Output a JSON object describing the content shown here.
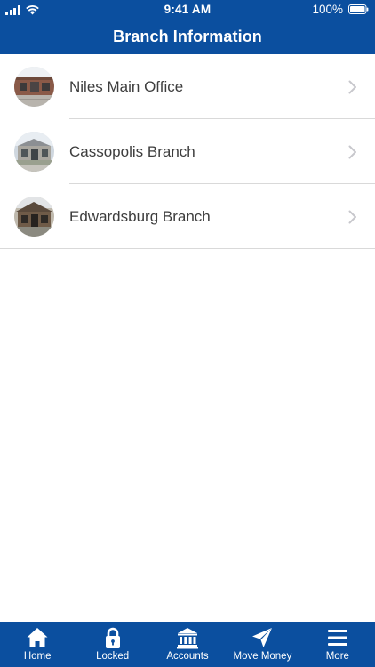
{
  "status_bar": {
    "time": "9:41 AM",
    "battery_percent": "100%"
  },
  "nav": {
    "title": "Branch Information"
  },
  "branches": [
    {
      "name": "Niles Main Office",
      "thumbnail": "niles-building-photo"
    },
    {
      "name": "Cassopolis Branch",
      "thumbnail": "cassopolis-building-photo"
    },
    {
      "name": "Edwardsburg Branch",
      "thumbnail": "edwardsburg-building-photo"
    }
  ],
  "tab_bar": {
    "items": [
      {
        "label": "Home",
        "icon": "home-icon"
      },
      {
        "label": "Locked",
        "icon": "lock-icon"
      },
      {
        "label": "Accounts",
        "icon": "bank-icon"
      },
      {
        "label": "Move Money",
        "icon": "send-icon"
      },
      {
        "label": "More",
        "icon": "menu-icon"
      }
    ]
  },
  "colors": {
    "brand_blue": "#0b4f9f",
    "background": "#ffffff",
    "divider": "#d9d9d9",
    "text": "#3d3d3d",
    "chevron": "#c7c7cc"
  }
}
